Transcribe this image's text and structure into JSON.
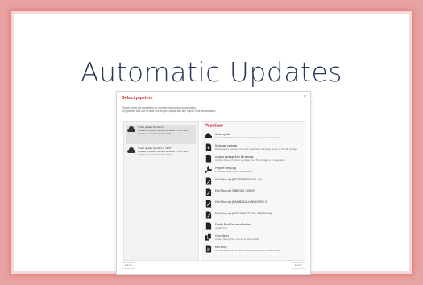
{
  "slide": {
    "title": "Automatic Updates"
  },
  "dialog": {
    "title": "Select pipeline",
    "close": "×",
    "description_1": "Please select the pipeline to be used for this product subscription.",
    "description_2": "All pipelines that use at least one Import Update and one Import Task are available.",
    "pipelines": [
      {
        "name": "Smart update for Inkprn",
        "desc": "Checks a product for new versions in APS and imports new versions into Inkprn.",
        "selected": true
      },
      {
        "name": "Smart update for Inkprn - TEST",
        "desc": "Checks a product for new versions in APS and imports new versions into Inkprn.",
        "selected": false
      }
    ],
    "preview": {
      "title": "Preview",
      "steps": [
        {
          "icon": "cloud-icon",
          "title": "Smart update",
          "desc": "Finds and download the newest package version of a product"
        },
        {
          "icon": "download-icon",
          "title": "Download package",
          "desc": "Downloads a package from the Application Package Depot to the file storage"
        },
        {
          "icon": "file-icon",
          "title": "Unzip a package from file storage",
          "desc": "Unzip a (zeed) conform package from file storage to a target path"
        },
        {
          "icon": "wrench-icon",
          "title": "Prepare Setup.cfg",
          "desc": "Prepares Setup.cfg for deployment"
        },
        {
          "icon": "edit-icon",
          "title": "Edit Setup.cfg (SETTEMPORATION = 1)",
          "desc": ""
        },
        {
          "icon": "edit-icon",
          "title": "Edit Setup.cfg (TIMEOUT = 20000)",
          "desc": ""
        },
        {
          "icon": "edit-icon",
          "title": "Edit Setup.cfg (MAXIMIZEALLWINDOWS = 0)",
          "desc": ""
        },
        {
          "icon": "edit-icon",
          "title": "Edit Setup.cfg (CONTINENTTYPE = CONTINEN)",
          "desc": ""
        },
        {
          "icon": "file-icon",
          "title": "Enable BlockExecutionFeature",
          "desc": "modify json"
        },
        {
          "icon": "copy-icon",
          "title": "Copy library",
          "desc": "Copies library from source to target folder"
        },
        {
          "icon": "script-icon",
          "title": "Run script",
          "desc": "Run a PowerShell or batch script file to perform custom tasks"
        }
      ]
    },
    "back_label": "BACK",
    "next_label": "NEXT"
  },
  "colors": {
    "accent": "#d0393b",
    "title": "#263758",
    "frame": "#e07a7a"
  }
}
